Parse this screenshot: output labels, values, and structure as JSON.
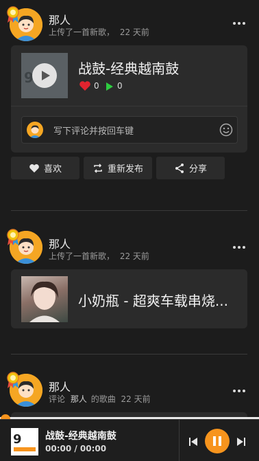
{
  "feed": [
    {
      "user": "那人",
      "meta_action": "上传了一首新歌，",
      "meta_time": "22 天前",
      "song_title": "战鼓-经典越南鼓",
      "likes": "0",
      "plays": "0",
      "comment_placeholder": "写下评论并按回车键"
    },
    {
      "user": "那人",
      "meta_action": "上传了一首新歌，",
      "meta_time": "22 天前",
      "song_title": "小奶瓶 - 超爽车载串烧..."
    },
    {
      "user": "那人",
      "meta_prefix": "评论",
      "meta_user": "那人",
      "meta_suffix": "的歌曲",
      "meta_time": "22 天前"
    }
  ],
  "actions": {
    "like": "喜欢",
    "repost": "重新发布",
    "share": "分享"
  },
  "player": {
    "title": "战鼓-经典越南鼓",
    "time": "00:00 / 00:00",
    "progress": 0
  },
  "colors": {
    "accent": "#f7941d",
    "like": "#e0242f",
    "play": "#2ecc40",
    "avatar": "#f5a623"
  },
  "icons": [
    "badge-icon",
    "more-icon",
    "play-icon",
    "heart-icon",
    "play-count-icon",
    "emoji-icon",
    "repost-icon",
    "share-icon",
    "prev-icon",
    "pause-icon",
    "next-icon"
  ]
}
